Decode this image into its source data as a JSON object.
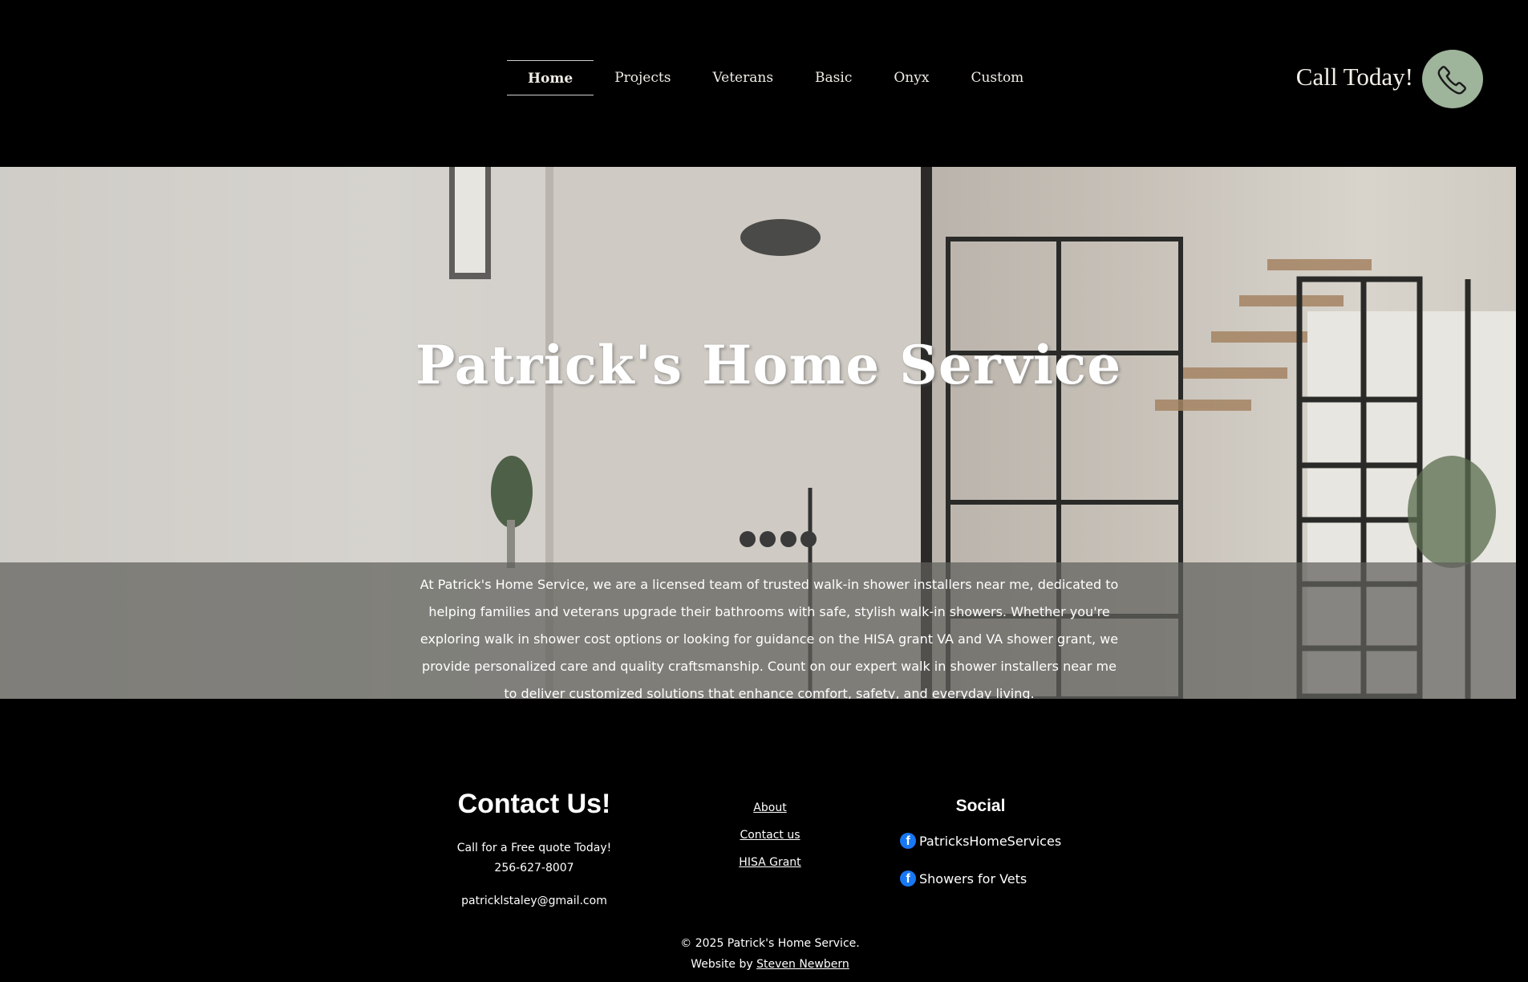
{
  "nav": {
    "items": [
      {
        "label": "Home",
        "active": true
      },
      {
        "label": "Projects"
      },
      {
        "label": "Veterans"
      },
      {
        "label": "Basic"
      },
      {
        "label": "Onyx"
      },
      {
        "label": "Custom"
      }
    ]
  },
  "call": {
    "text": "Call Today!",
    "icon": "phone-icon",
    "button_color": "#9eb49b"
  },
  "hero": {
    "title": "Patrick's Home Service",
    "description": "At Patrick's Home Service, we are a licensed team of trusted walk-in shower installers near me, dedicated to helping families and veterans upgrade their bathrooms with safe, stylish walk-in showers. Whether you're exploring walk in shower cost options or looking for guidance on the HISA grant VA and VA shower grant, we provide personalized care and quality craftsmanship. Count on our expert walk in shower installers near me to deliver customized solutions that enhance comfort, safety, and everyday living."
  },
  "footer": {
    "contact": {
      "title": "Contact Us!",
      "quote_line": "Call for a Free quote Today!",
      "phone": "256-627-8007",
      "email": "patricklstaley@gmail.com"
    },
    "links": [
      "About",
      "Contact us",
      "HISA Grant"
    ],
    "social": {
      "title": "Social",
      "items": [
        {
          "label": "PatricksHomeServices",
          "icon": "facebook-icon"
        },
        {
          "label": "Showers for Vets",
          "icon": "facebook-icon"
        }
      ]
    },
    "copyright": "© 2025 Patrick's Home Service.",
    "credit_prefix": "Website by",
    "credit_name": "Steven Newbern"
  },
  "colors": {
    "background": "#000000",
    "call_button": "#9eb49b",
    "facebook": "#1877f2"
  }
}
